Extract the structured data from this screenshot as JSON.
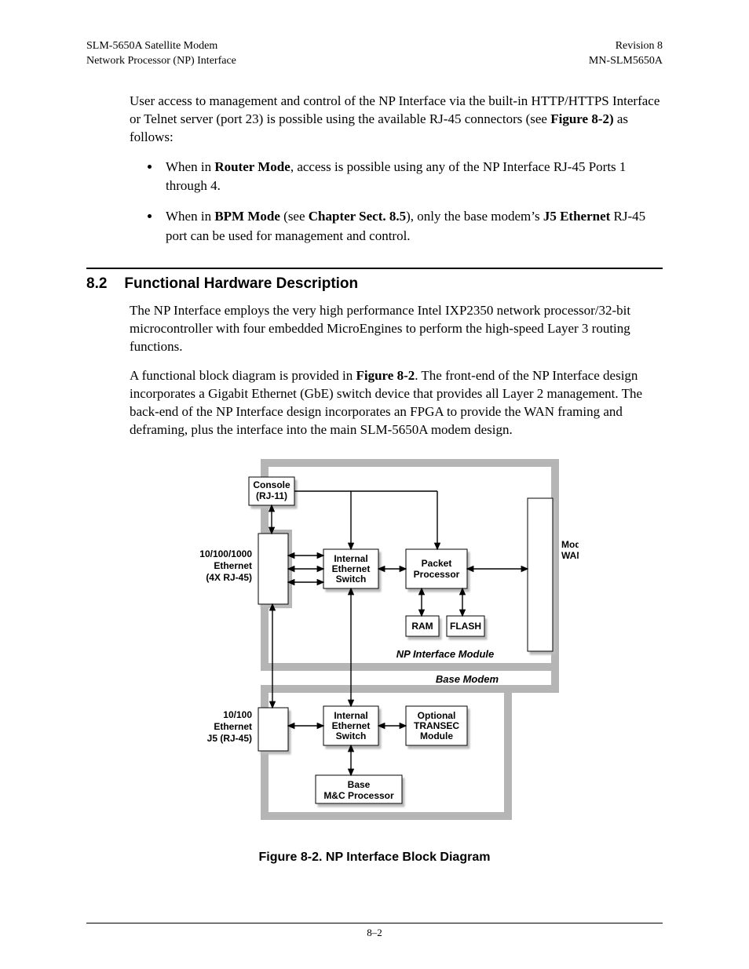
{
  "header": {
    "left1": "SLM-5650A Satellite Modem",
    "left2": "Network Processor (NP) Interface",
    "right1": "Revision 8",
    "right2": "MN-SLM5650A"
  },
  "intro": {
    "p1a": "User access to management and control of the NP Interface via the built-in HTTP/HTTPS Interface or Telnet server (port 23) is possible using the available RJ-45 connectors (see ",
    "p1b": "Figure 8-2)",
    "p1c": " as follows:"
  },
  "bullets": {
    "b1a": "When in ",
    "b1b": "Router Mode",
    "b1c": ", access is possible using any of the NP Interface RJ-45 Ports 1 through 4.",
    "b2a": "When in ",
    "b2b": "BPM Mode",
    "b2c": " (see ",
    "b2d": "Chapter Sect. 8.5",
    "b2e": "), only the base modem’s ",
    "b2f": "J5 Ethernet",
    "b2g": " RJ-45 port can be used for management and control."
  },
  "section": {
    "num": "8.2",
    "title": "Functional Hardware Description",
    "p1": "The NP Interface employs the very high performance Intel IXP2350 network processor/32-bit microcontroller with four embedded MicroEngines to perform the high-speed Layer 3 routing functions.",
    "p2a": "A functional block diagram is provided in ",
    "p2b": "Figure 8-2",
    "p2c": ". The front-end of the NP Interface design incorporates a Gigabit Ethernet (GbE) switch device that provides all Layer 2 management. The back-end of the NP Interface design incorporates an FPGA to provide the WAN framing and deframing, plus the interface into the main SLM-5650A modem design."
  },
  "diagram": {
    "console1": "Console",
    "console2": "(RJ-11)",
    "eth1": "10/100/1000",
    "eth2": "Ethernet",
    "eth3": "(4X RJ-45)",
    "isw1": "Internal",
    "isw2": "Ethernet",
    "isw3": "Switch",
    "pp1": "Packet",
    "pp2": "Processor",
    "ram": "RAM",
    "flash": "FLASH",
    "wan1": "Modem",
    "wan2": "WAN",
    "npmod": "NP Interface Module",
    "basemodem": "Base Modem",
    "eth100_1": "10/100",
    "eth100_2": "Ethernet",
    "eth100_3": "J5 (RJ-45)",
    "opt1": "Optional",
    "opt2": "TRANSEC",
    "opt3": "Module",
    "mc1": "Base",
    "mc2": "M&C Processor"
  },
  "figcaption": "Figure 8-2. NP Interface Block Diagram",
  "pgnum": "8–2"
}
